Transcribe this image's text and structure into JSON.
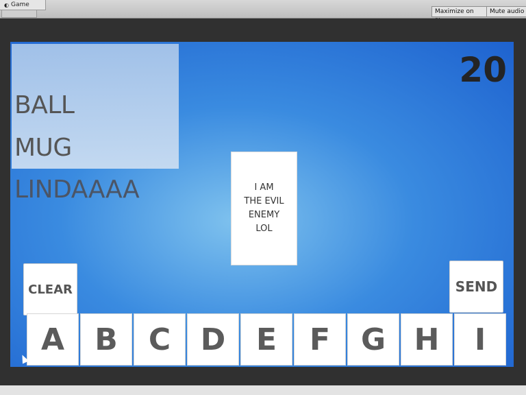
{
  "editor": {
    "tab_label": "Game",
    "tab_icon": "unity-game-icon",
    "toolbar": {
      "maximize_on_play": "Maximize on Play",
      "mute_audio": "Mute audio"
    }
  },
  "game": {
    "score": "20",
    "words": [
      "BALL",
      "MUG",
      "LINDAAAA"
    ],
    "enemy_text": "I AM\nTHE EVIL\nENEMY\nLOL",
    "clear_label": "CLEAR",
    "send_label": "SEND",
    "letters": [
      "A",
      "B",
      "C",
      "D",
      "E",
      "F",
      "G",
      "H",
      "I"
    ]
  }
}
